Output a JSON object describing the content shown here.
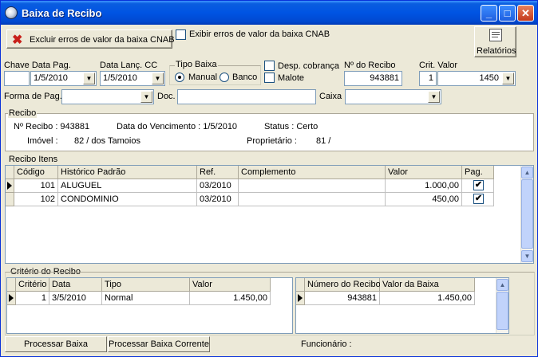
{
  "window": {
    "title": "Baixa de Recibo"
  },
  "toolbar": {
    "exclude_errors_label": "Excluir erros de valor da baixa CNAB",
    "show_errors_label": "Exibir erros de valor da baixa CNAB",
    "reports_label": "Relatórios"
  },
  "filters": {
    "chave_label": "Chave Data Pag.",
    "chave_value": "",
    "data_pag_value": "1/5/2010",
    "data_lanc_label": "Data Lanç. CC",
    "data_lanc_value": "1/5/2010",
    "tipo_baixa_label": "Tipo Baixa",
    "manual_label": "Manual",
    "banco_label": "Banco",
    "desp_cobranca_label": "Desp. cobrança",
    "malote_label": "Malote",
    "num_recibo_label": "Nº do Recibo",
    "num_recibo_value": "943881",
    "crit_valor_label": "Crit. Valor",
    "crit_num_value": "1",
    "crit_valor_value": "1450",
    "forma_pag_label": "Forma de Pag.",
    "forma_pag_value": "",
    "doc_label": "Doc.",
    "doc_value": "",
    "caixa_label": "Caixa",
    "caixa_value": ""
  },
  "recibo": {
    "section_label": "Recibo",
    "num_recibo_text": "Nº Recibo : 943881",
    "vencimento_text": "Data do Vencimento : 1/5/2010",
    "status_text": "Status : Certo",
    "imovel_label": "Imóvel :",
    "imovel_value": "82 /  dos Tamoios",
    "proprietario_label": "Proprietário :",
    "proprietario_value": "81 /"
  },
  "itens": {
    "section_label": "Recibo Itens",
    "columns": [
      "Código",
      "Histórico Padrão",
      "Ref.",
      "Complemento",
      "Valor",
      "Pag."
    ],
    "rows": [
      {
        "codigo": "101",
        "historico": "ALUGUEL",
        "ref": "03/2010",
        "complemento": "",
        "valor": "1.000,00",
        "pag": "✔"
      },
      {
        "codigo": "102",
        "historico": "CONDOMINIO",
        "ref": "03/2010",
        "complemento": "",
        "valor": "450,00",
        "pag": "✔"
      }
    ]
  },
  "criterio": {
    "section_label": "Critério do Recibo",
    "columns": [
      "Critério",
      "Data",
      "Tipo",
      "Valor"
    ],
    "rows": [
      {
        "criterio": "1",
        "data": "3/5/2010",
        "tipo": "Normal",
        "valor": "1.450,00"
      }
    ],
    "baixa_columns": [
      "Número do Recibo",
      "Valor da Baixa"
    ],
    "baixa_rows": [
      {
        "numero": "943881",
        "valor": "1.450,00"
      }
    ]
  },
  "footer": {
    "processar_label": "Processar Baixa",
    "processar_corrente_label": "Processar Baixa Corrente",
    "funcionario_label": "Funcionário :"
  }
}
